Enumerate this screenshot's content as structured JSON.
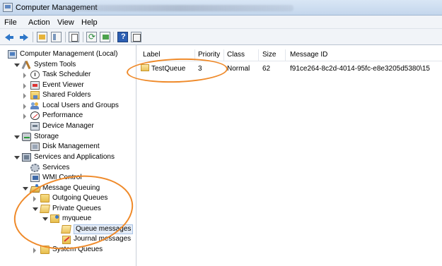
{
  "window": {
    "title": "Computer Management"
  },
  "menu": [
    "File",
    "Action",
    "View",
    "Help"
  ],
  "toolbar": {
    "buttons": [
      "back-icon",
      "forward-icon",
      "up-icon",
      "show-hide-tree-icon",
      "properties-icon",
      "refresh-icon",
      "export-list-icon",
      "help-icon",
      "view-icon"
    ]
  },
  "tree": [
    {
      "label": "Computer Management (Local)",
      "icon": "computer-icon",
      "expander": "none",
      "level": 0
    },
    {
      "label": "System Tools",
      "icon": "tools-icon",
      "expander": "open",
      "level": 1
    },
    {
      "label": "Task Scheduler",
      "icon": "clock-icon",
      "expander": "closed",
      "level": 2
    },
    {
      "label": "Event Viewer",
      "icon": "event-viewer-icon",
      "expander": "closed",
      "level": 2
    },
    {
      "label": "Shared Folders",
      "icon": "shared-folder-icon",
      "expander": "closed",
      "level": 2
    },
    {
      "label": "Local Users and Groups",
      "icon": "users-icon",
      "expander": "closed",
      "level": 2
    },
    {
      "label": "Performance",
      "icon": "performance-icon",
      "expander": "closed",
      "level": 2
    },
    {
      "label": "Device Manager",
      "icon": "device-icon",
      "expander": "none",
      "level": 2
    },
    {
      "label": "Storage",
      "icon": "storage-icon",
      "expander": "open",
      "level": 1
    },
    {
      "label": "Disk Management",
      "icon": "disk-icon",
      "expander": "none",
      "level": 2
    },
    {
      "label": "Services and Applications",
      "icon": "services-applications-icon",
      "expander": "open",
      "level": 1
    },
    {
      "label": "Services",
      "icon": "gear-icon",
      "expander": "none",
      "level": 2
    },
    {
      "label": "WMI Control",
      "icon": "wmi-icon",
      "expander": "none",
      "level": 2
    },
    {
      "label": "Message Queuing",
      "icon": "message-queuing-icon",
      "expander": "open",
      "level": 2
    },
    {
      "label": "Outgoing Queues",
      "icon": "folder-icon",
      "expander": "closed",
      "level": 3
    },
    {
      "label": "Private Queues",
      "icon": "folder-open-icon",
      "expander": "open",
      "level": 3
    },
    {
      "label": "myqueue",
      "icon": "queue-icon",
      "expander": "open",
      "level": 4
    },
    {
      "label": "Queue messages",
      "icon": "folder-open-icon",
      "expander": "none",
      "level": 5,
      "selected": true
    },
    {
      "label": "Journal messages",
      "icon": "journal-icon",
      "expander": "none",
      "level": 5
    },
    {
      "label": "System Queues",
      "icon": "folder-icon",
      "expander": "closed",
      "level": 3
    }
  ],
  "list": {
    "columns": [
      "Label",
      "Priority",
      "Class",
      "Size",
      "Message ID"
    ],
    "rows": [
      {
        "label": "TestQueue",
        "priority": "3",
        "class": "Normal",
        "size": "62",
        "message_id": "f91ce264-8c2d-4014-95fc-e8e3205d5380\\15"
      }
    ]
  },
  "colors": {
    "annotation": "#ef8a2a",
    "selection": "#e4ecf7"
  }
}
